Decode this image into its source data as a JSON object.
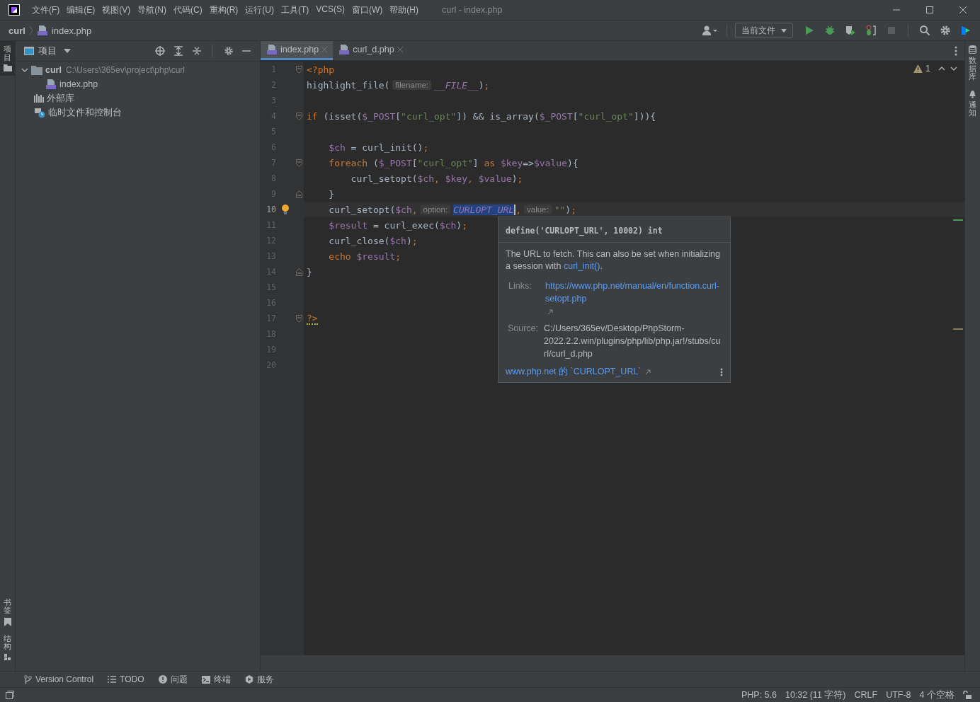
{
  "window": {
    "title": "curl - index.php"
  },
  "menu": [
    "文件(F)",
    "编辑(E)",
    "视图(V)",
    "导航(N)",
    "代码(C)",
    "重构(R)",
    "运行(U)",
    "工具(T)",
    "VCS(S)",
    "窗口(W)",
    "帮助(H)"
  ],
  "breadcrumb": [
    "curl",
    "index.php"
  ],
  "run_config": "当前文件",
  "left_strip": [
    {
      "label": "项目",
      "selected": true,
      "kind": "folder"
    },
    {
      "label": "书签",
      "selected": false,
      "kind": "bookmark"
    },
    {
      "label": "结构",
      "selected": false,
      "kind": "structure"
    }
  ],
  "right_strip": [
    {
      "label": "数据库",
      "kind": "database"
    },
    {
      "label": "通知",
      "kind": "bell"
    }
  ],
  "project": {
    "title": "项目",
    "tree": [
      {
        "label": "curl",
        "kind": "folder",
        "path": "C:\\Users\\365ev\\project\\php\\curl",
        "expanded": true,
        "children": [
          {
            "label": "index.php",
            "kind": "php"
          }
        ]
      },
      {
        "label": "外部库",
        "kind": "library"
      },
      {
        "label": "临时文件和控制台",
        "kind": "scratch"
      }
    ]
  },
  "tabs": [
    {
      "label": "index.php",
      "selected": true
    },
    {
      "label": "curl_d.php",
      "selected": false
    }
  ],
  "inspections": {
    "warnings": "1"
  },
  "lines": [
    {
      "number": "1",
      "fold_start": true,
      "tokens": [
        {
          "kind": "tag",
          "text": "<?php"
        }
      ]
    },
    {
      "number": "2",
      "tokens": [
        {
          "kind": "plain",
          "text": "highlight_file("
        },
        {
          "kind": "hint",
          "text": "filename:"
        },
        {
          "kind": "const",
          "text": "__FILE__"
        },
        {
          "kind": "plain",
          "text": ")"
        },
        {
          "kind": "punct",
          "text": ";"
        }
      ]
    },
    {
      "number": "3"
    },
    {
      "number": "4",
      "fold_start": true,
      "tokens": [
        {
          "kind": "kw",
          "text": "if"
        },
        {
          "kind": "plain",
          "text": " (isset("
        },
        {
          "kind": "var",
          "text": "$_POST"
        },
        {
          "kind": "plain",
          "text": "["
        },
        {
          "kind": "str",
          "text": "\"curl_opt\""
        },
        {
          "kind": "plain",
          "text": "]) && is_array("
        },
        {
          "kind": "var",
          "text": "$_POST"
        },
        {
          "kind": "plain",
          "text": "["
        },
        {
          "kind": "str",
          "text": "\"curl_opt\""
        },
        {
          "kind": "plain",
          "text": "])){"
        }
      ]
    },
    {
      "number": "5"
    },
    {
      "number": "6",
      "tokens": [
        {
          "kind": "var",
          "text": "    $ch"
        },
        {
          "kind": "plain",
          "text": " = curl_init()"
        },
        {
          "kind": "punct",
          "text": ";"
        }
      ]
    },
    {
      "number": "7",
      "fold_start": true,
      "tokens": [
        {
          "kind": "kw",
          "text": "    foreach"
        },
        {
          "kind": "plain",
          "text": " ("
        },
        {
          "kind": "var",
          "text": "$_POST"
        },
        {
          "kind": "plain",
          "text": "["
        },
        {
          "kind": "str",
          "text": "\"curl_opt\""
        },
        {
          "kind": "plain",
          "text": "] "
        },
        {
          "kind": "kw",
          "text": "as"
        },
        {
          "kind": "var",
          "text": " $key"
        },
        {
          "kind": "plain",
          "text": "=>"
        },
        {
          "kind": "var",
          "text": "$value"
        },
        {
          "kind": "plain",
          "text": "){"
        }
      ]
    },
    {
      "number": "8",
      "tokens": [
        {
          "kind": "plain",
          "text": "        curl_setopt("
        },
        {
          "kind": "var",
          "text": "$ch"
        },
        {
          "kind": "punct",
          "text": ","
        },
        {
          "kind": "var",
          "text": " $key"
        },
        {
          "kind": "punct",
          "text": ","
        },
        {
          "kind": "var",
          "text": " $value"
        },
        {
          "kind": "plain",
          "text": ")"
        },
        {
          "kind": "punct",
          "text": ";"
        }
      ]
    },
    {
      "number": "9",
      "fold_end": true,
      "tokens": [
        {
          "kind": "plain",
          "text": "    }"
        }
      ]
    },
    {
      "number": "10",
      "current": true,
      "bulb": true,
      "tokens": [
        {
          "kind": "plain",
          "text": "    curl_setopt("
        },
        {
          "kind": "var",
          "text": "$ch"
        },
        {
          "kind": "punct",
          "text": ","
        },
        {
          "kind": "hint",
          "text": "option:"
        },
        {
          "kind": "match",
          "text": "CURLOPT_URL"
        },
        {
          "kind": "punct",
          "text": ","
        },
        {
          "kind": "hint",
          "text": "value:"
        },
        {
          "kind": "str",
          "text": "\"\""
        },
        {
          "kind": "plain",
          "text": ")"
        },
        {
          "kind": "punct",
          "text": ";"
        }
      ]
    },
    {
      "number": "11",
      "tokens": [
        {
          "kind": "var",
          "text": "    $result"
        },
        {
          "kind": "plain",
          "text": " = curl_exec("
        },
        {
          "kind": "var",
          "text": "$ch"
        },
        {
          "kind": "plain",
          "text": ")"
        },
        {
          "kind": "punct",
          "text": ";"
        }
      ]
    },
    {
      "number": "12",
      "tokens": [
        {
          "kind": "plain",
          "text": "    curl_close("
        },
        {
          "kind": "var",
          "text": "$ch"
        },
        {
          "kind": "plain",
          "text": ")"
        },
        {
          "kind": "punct",
          "text": ";"
        }
      ]
    },
    {
      "number": "13",
      "tokens": [
        {
          "kind": "kw",
          "text": "    echo"
        },
        {
          "kind": "var",
          "text": " $result"
        },
        {
          "kind": "punct",
          "text": ";"
        }
      ]
    },
    {
      "number": "14",
      "fold_end": true,
      "tokens": [
        {
          "kind": "plain",
          "text": "}"
        }
      ]
    },
    {
      "number": "15"
    },
    {
      "number": "16"
    },
    {
      "number": "17",
      "fold_start": true,
      "tokens": [
        {
          "kind": "tag",
          "text": "?>",
          "squiggle": true
        }
      ]
    },
    {
      "number": "18"
    },
    {
      "number": "19"
    },
    {
      "number": "20"
    }
  ],
  "doc_popup": {
    "signature": "define('CURLOPT_URL', 10002) int",
    "description": {
      "text": "The URL to fetch. This can also be set when initializing a session with ",
      "link": "curl_init()",
      "end": "."
    },
    "links_label": "Links:",
    "link": "https://www.php.net/manual/en/function.curl-setopt.php",
    "source_label": "Source:",
    "source": "C:/Users/365ev/Desktop/PhpStorm-2022.2.2.win/plugins/php/lib/php.jar!/stubs/curl/curl_d.php",
    "footer_link": "www.php.net 的 `CURLOPT_URL`"
  },
  "tool_windows": [
    {
      "label": "Version Control",
      "kind": "vcs"
    },
    {
      "label": "TODO",
      "kind": "todo"
    },
    {
      "label": "问题",
      "kind": "problems"
    },
    {
      "label": "终端",
      "kind": "terminal"
    },
    {
      "label": "服务",
      "kind": "services"
    }
  ],
  "status_bar": [
    "PHP: 5.6",
    "10:32 (11 字符)",
    "CRLF",
    "UTF-8",
    "4 个空格"
  ]
}
